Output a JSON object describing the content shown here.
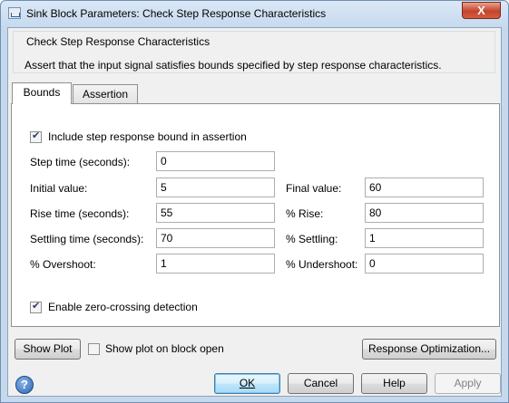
{
  "window": {
    "title": "Sink Block Parameters: Check Step Response Characteristics",
    "close_glyph": "X"
  },
  "group": {
    "title": "Check Step Response Characteristics",
    "description": "Assert that the input signal satisfies bounds specified by step response characteristics."
  },
  "tabs": [
    {
      "label": "Bounds",
      "active": true
    },
    {
      "label": "Assertion",
      "active": false
    }
  ],
  "bounds": {
    "include_bound_label": "Include step response bound in assertion",
    "include_bound_checked": true,
    "step_time_label": "Step time (seconds):",
    "step_time_value": "0",
    "initial_value_label": "Initial value:",
    "initial_value_value": "5",
    "final_value_label": "Final value:",
    "final_value_value": "60",
    "rise_time_label": "Rise time (seconds):",
    "rise_time_value": "55",
    "pct_rise_label": "% Rise:",
    "pct_rise_value": "80",
    "settling_time_label": "Settling time (seconds):",
    "settling_time_value": "70",
    "pct_settling_label": "% Settling:",
    "pct_settling_value": "1",
    "overshoot_label": "% Overshoot:",
    "overshoot_value": "1",
    "undershoot_label": "% Undershoot:",
    "undershoot_value": "0",
    "zero_crossing_label": "Enable zero-crossing detection",
    "zero_crossing_checked": true
  },
  "footer": {
    "show_plot_label": "Show Plot",
    "show_plot_on_open_label": "Show plot on block open",
    "show_plot_on_open_checked": false,
    "response_optimization_label": "Response Optimization...",
    "ok_label": "OK",
    "cancel_label": "Cancel",
    "help_label": "Help",
    "apply_label": "Apply",
    "help_icon_glyph": "?"
  }
}
